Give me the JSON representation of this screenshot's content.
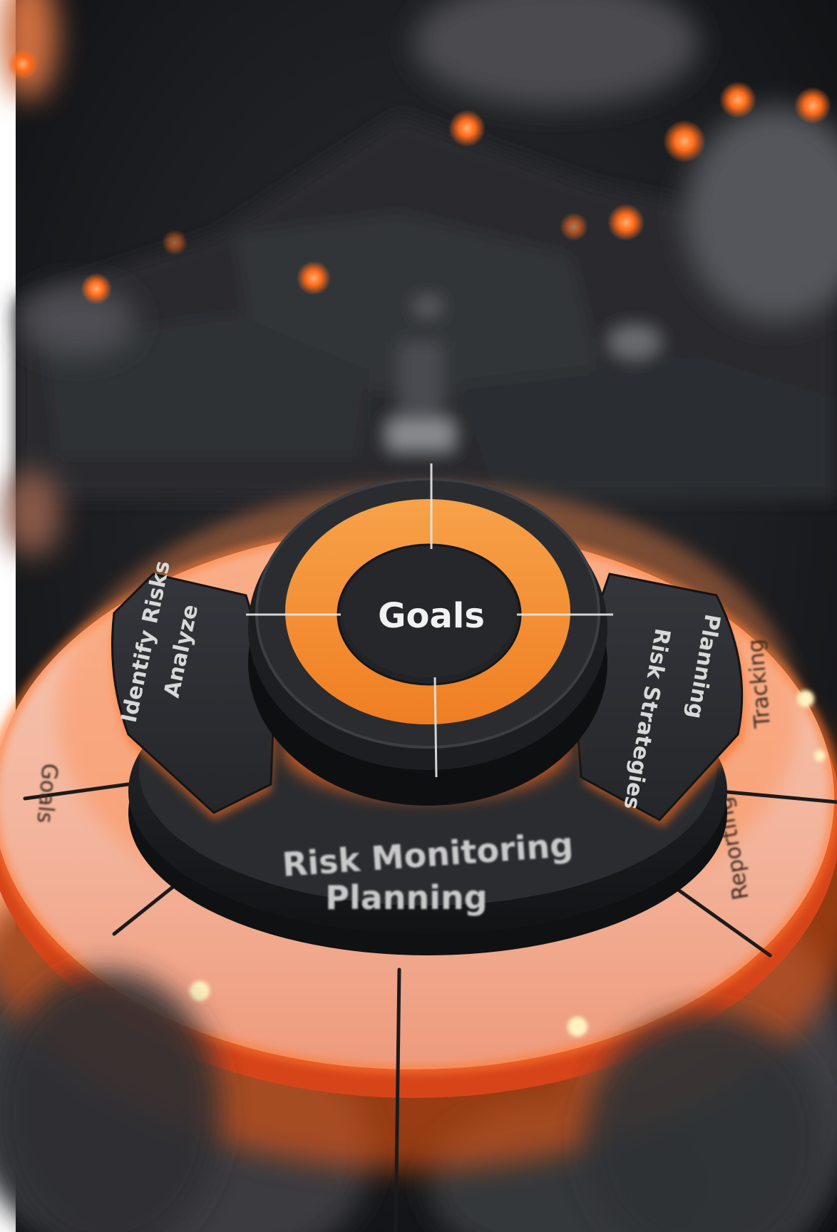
{
  "center": {
    "label": "Goals"
  },
  "segments": {
    "bottom_line1": "Risk Monitoring",
    "bottom_line2": "Planning",
    "left_line1": "Identify Risks",
    "left_line2": "Analyze",
    "right_line1": "Risk Strategies",
    "right_line2": "Planning"
  },
  "outer_ring": {
    "left_label": "Goals",
    "right_label": "Tracking",
    "right_lower_label": "Reporting"
  },
  "colors": {
    "accent": "#f28a2c",
    "accent_glow": "#ff6a1a",
    "hub_dark": "#1f2023",
    "background": "#16171a",
    "text": "#e9e9e9"
  }
}
